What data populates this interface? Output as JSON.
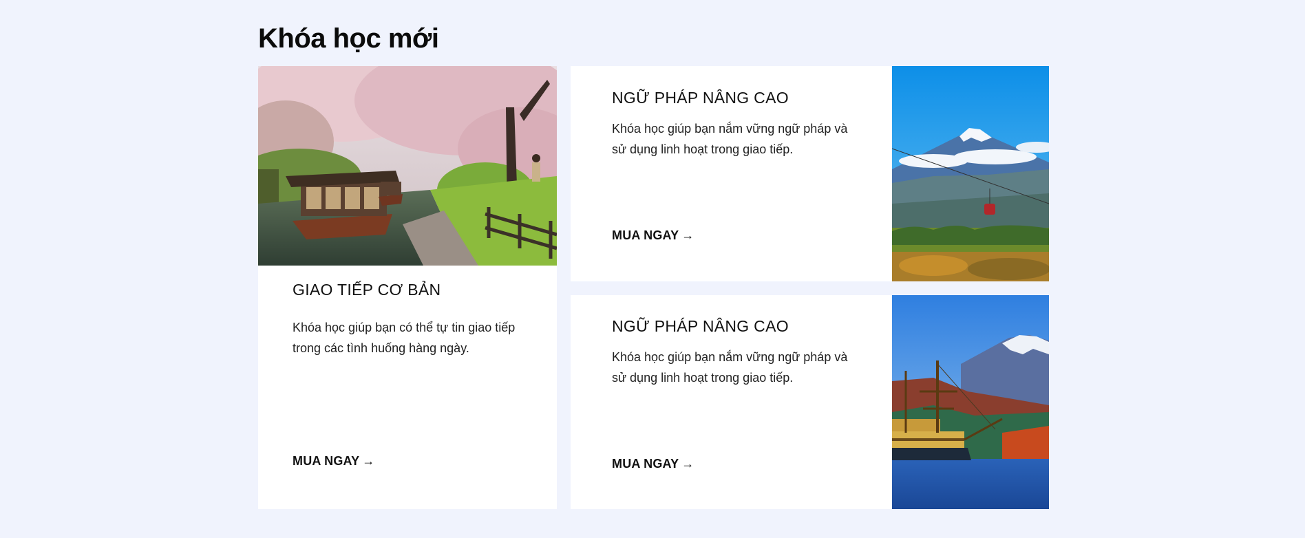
{
  "section": {
    "title": "Khóa học mới"
  },
  "courses": [
    {
      "title": "GIAO TIẾP CƠ BẢN",
      "description": "Khóa học giúp bạn có thể tự tin giao tiếp trong các tình huống hàng ngày.",
      "cta": "MUA NGAY",
      "image": "cherry-blossom-canal-boat"
    },
    {
      "title": "NGỮ PHÁP NÂNG CAO",
      "description": "Khóa học giúp bạn nắm vững ngữ pháp và sử dụng linh hoạt trong giao tiếp.",
      "cta": "MUA NGAY",
      "image": "mount-fuji-ropeway"
    },
    {
      "title": "NGỮ PHÁP NÂNG CAO",
      "description": "Khóa học giúp bạn nắm vững ngữ pháp và sử dụng linh hoạt trong giao tiếp.",
      "cta": "MUA NGAY",
      "image": "mount-fuji-pirate-ship"
    }
  ],
  "icons": {
    "cta_arrow": "arrow-right-icon"
  },
  "colors": {
    "background": "#f0f3fd",
    "card": "#ffffff",
    "text": "#111111"
  }
}
